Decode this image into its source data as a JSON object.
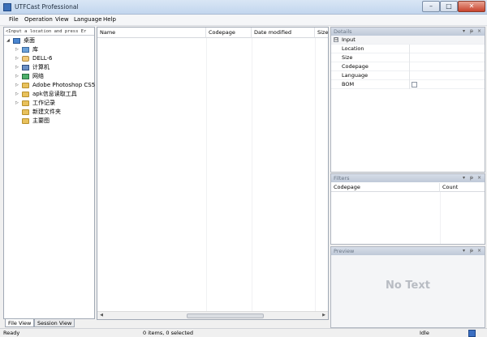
{
  "window": {
    "title": "UTFCast Professional"
  },
  "menu": [
    "File",
    "Operation",
    "View",
    "Language",
    "Help"
  ],
  "tree": {
    "path_placeholder": "<Input a location and press Er",
    "items": [
      {
        "label": "桌面",
        "icon": "desktop-icon",
        "level": 0
      },
      {
        "label": "库",
        "icon": "library-icon",
        "level": 1
      },
      {
        "label": "DELL-6",
        "icon": "user-folder-icon",
        "level": 1
      },
      {
        "label": "计算机",
        "icon": "computer-icon",
        "level": 1
      },
      {
        "label": "网络",
        "icon": "network-icon",
        "level": 1
      },
      {
        "label": "Adobe Photoshop CS5",
        "icon": "folder-icon",
        "level": 1
      },
      {
        "label": "apk信息读取工具",
        "icon": "folder-icon",
        "level": 1
      },
      {
        "label": "工作记录",
        "icon": "folder-icon",
        "level": 1
      },
      {
        "label": "新建文件夹",
        "icon": "folder-icon",
        "level": 1
      },
      {
        "label": "主要图",
        "icon": "folder-icon",
        "level": 1
      }
    ]
  },
  "tabs": [
    "File View",
    "Session View"
  ],
  "file_list": {
    "columns": [
      "Name",
      "Codepage",
      "Date modified",
      "Size"
    ]
  },
  "details": {
    "title": "Details",
    "category": "Input",
    "category_toggle": "⊟",
    "props": [
      "Location",
      "Size",
      "Codepage",
      "Language",
      "BOM"
    ]
  },
  "filters": {
    "title": "Filters",
    "columns": [
      "Codepage",
      "Count"
    ]
  },
  "preview": {
    "title": "Preview",
    "empty_text": "No Text"
  },
  "dock_controls": {
    "dropdown": "▾",
    "pin": "ᵽ",
    "close": "×"
  },
  "status": {
    "left": "Ready",
    "center": "0 items, 0 selected",
    "right": "Idle"
  }
}
